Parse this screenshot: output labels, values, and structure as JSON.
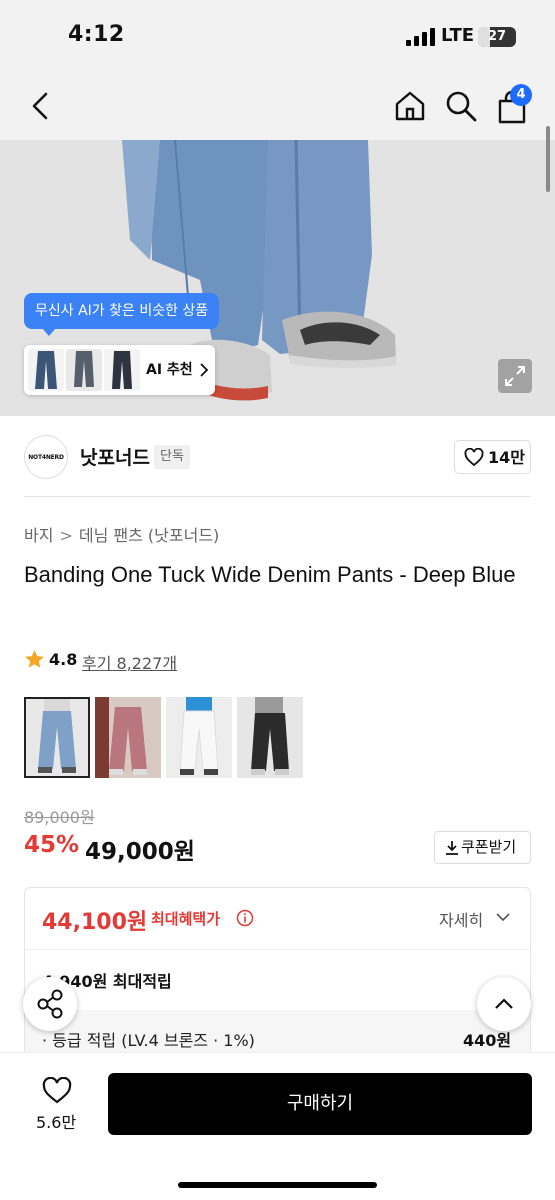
{
  "status_bar": {
    "time": "4:12",
    "network": "LTE",
    "battery": "27"
  },
  "nav": {
    "cart_count": "4"
  },
  "hero": {
    "ai_bubble": "무신사 AI가 찾은 비슷한 상품",
    "ai_recommend_label": "AI 추천"
  },
  "brand": {
    "logo_text": "NOT4NERD",
    "name": "낫포너드",
    "tag": "단독",
    "likes": "14만"
  },
  "breadcrumb": {
    "category": "바지",
    "separator": ">",
    "subcategory": "데님 팬츠 (낫포너드)"
  },
  "product": {
    "title": "Banding One Tuck Wide Denim Pants - Deep Blue",
    "rating": "4.8",
    "review_text": "후기 8,227개",
    "original_price": "89,000원",
    "discount": "45%",
    "sale_price": "49,000원",
    "coupon_label": "쿠폰받기"
  },
  "benefit": {
    "max_price": "44,100원",
    "max_label": "최대혜택가",
    "detail_label": "자세히",
    "points": "4,940원 최대적립",
    "grade_label": "· 등급 적립 (LV.4 브론즈 · 1%)",
    "grade_value": "440원"
  },
  "bottom_bar": {
    "like_count": "5.6만",
    "buy_label": "구매하기"
  },
  "colors": {
    "accent_red": "#e53935",
    "accent_blue": "#3b82f6",
    "buy_button": "#000000"
  },
  "thumbnails": [
    "deep-blue",
    "pink",
    "white",
    "black"
  ]
}
